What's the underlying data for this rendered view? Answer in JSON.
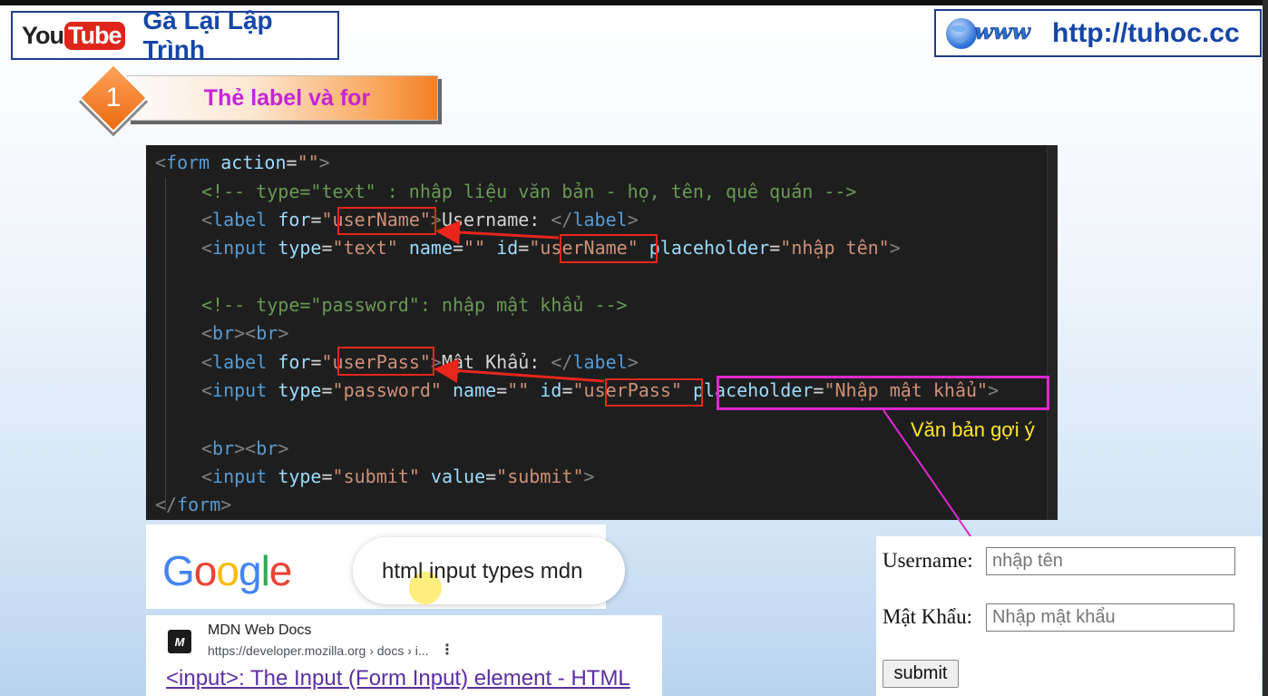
{
  "header": {
    "youtube_you": "You",
    "youtube_tube": "Tube",
    "channel_name": "Gà Lại Lập Trình",
    "site_url": "http://tuhoc.cc"
  },
  "step": {
    "number": "1",
    "title": "Thẻ label và for"
  },
  "code_annotation": "Văn bản gợi ý",
  "google": {
    "query": "html input types mdn"
  },
  "search_result": {
    "icon_text": "M",
    "site_name": "MDN Web Docs",
    "url": "https://developer.mozilla.org › docs › i...",
    "title": "<input>: The Input (Form Input) element - HTML"
  },
  "form_preview": {
    "username_label": "Username:",
    "username_placeholder": "nhập tên",
    "password_label": "Mật Khẩu:",
    "password_placeholder": "Nhập mật khẩu",
    "submit_label": "submit"
  },
  "colors": {
    "highlight_box": "#e8261c",
    "placeholder_box": "#e028d0",
    "annotation_text": "#ffe82e"
  }
}
